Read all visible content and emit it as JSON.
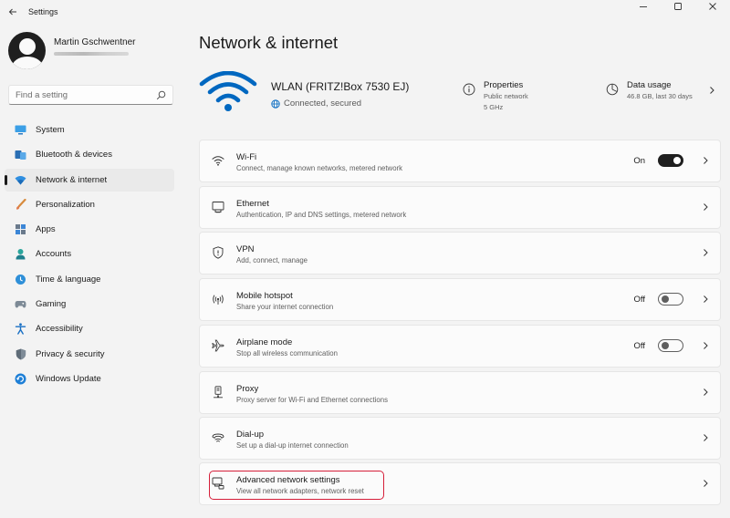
{
  "window": {
    "title": "Settings"
  },
  "profile": {
    "name": "Martin Gschwentner"
  },
  "search": {
    "placeholder": "Find a setting"
  },
  "nav": {
    "items": [
      {
        "label": "System",
        "icon": "system-icon"
      },
      {
        "label": "Bluetooth & devices",
        "icon": "bluetooth-icon"
      },
      {
        "label": "Network & internet",
        "icon": "network-icon",
        "active": true
      },
      {
        "label": "Personalization",
        "icon": "brush-icon"
      },
      {
        "label": "Apps",
        "icon": "apps-icon"
      },
      {
        "label": "Accounts",
        "icon": "accounts-icon"
      },
      {
        "label": "Time & language",
        "icon": "time-language-icon"
      },
      {
        "label": "Gaming",
        "icon": "gaming-icon"
      },
      {
        "label": "Accessibility",
        "icon": "accessibility-icon"
      },
      {
        "label": "Privacy & security",
        "icon": "shield-icon"
      },
      {
        "label": "Windows Update",
        "icon": "windows-update-icon"
      }
    ]
  },
  "page": {
    "title": "Network & internet"
  },
  "connection": {
    "name": "WLAN (FRITZ!Box 7530 EJ)",
    "status": "Connected, secured"
  },
  "properties": {
    "title": "Properties",
    "network_type": "Public network",
    "band": "5 GHz"
  },
  "data_usage": {
    "title": "Data usage",
    "value": "46.8 GB, last 30 days"
  },
  "cards": [
    {
      "title": "Wi-Fi",
      "subtitle": "Connect, manage known networks, metered network",
      "icon": "wifi-icon",
      "toggle": "On"
    },
    {
      "title": "Ethernet",
      "subtitle": "Authentication, IP and DNS settings, metered network",
      "icon": "ethernet-icon"
    },
    {
      "title": "VPN",
      "subtitle": "Add, connect, manage",
      "icon": "vpn-shield-icon"
    },
    {
      "title": "Mobile hotspot",
      "subtitle": "Share your internet connection",
      "icon": "hotspot-icon",
      "toggle": "Off"
    },
    {
      "title": "Airplane mode",
      "subtitle": "Stop all wireless communication",
      "icon": "airplane-icon",
      "toggle": "Off"
    },
    {
      "title": "Proxy",
      "subtitle": "Proxy server for Wi-Fi and Ethernet connections",
      "icon": "proxy-icon"
    },
    {
      "title": "Dial-up",
      "subtitle": "Set up a dial-up internet connection",
      "icon": "dialup-icon"
    },
    {
      "title": "Advanced network settings",
      "subtitle": "View all network adapters, network reset",
      "icon": "advanced-network-icon",
      "highlighted": true
    }
  ],
  "colors": {
    "accent": "#0067c0",
    "highlight": "#d61f3a",
    "background": "#f3f3f3",
    "card": "#fbfbfb"
  }
}
